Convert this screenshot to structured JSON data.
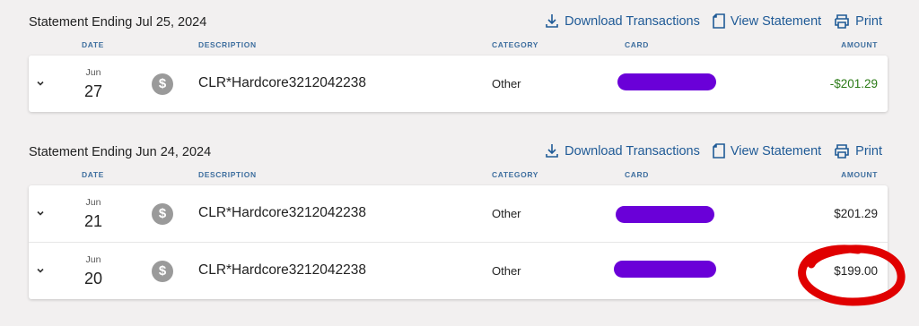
{
  "columns": {
    "date": "DATE",
    "description": "DESCRIPTION",
    "category": "CATEGORY",
    "card": "CARD",
    "amount": "AMOUNT"
  },
  "actions": {
    "download": "Download Transactions",
    "view": "View Statement",
    "print": "Print"
  },
  "colors": {
    "link": "#1f5a96",
    "redaction": "#6a00d8",
    "credit_amount": "#2b7a16",
    "annotation": "#e00000"
  },
  "statements": [
    {
      "title": "Statement Ending Jul 25, 2024",
      "transactions": [
        {
          "month": "Jun",
          "day": "27",
          "description": "CLR*Hardcore3212042238",
          "category": "Other",
          "amount": "-$201.29",
          "icon": "dollar-icon"
        }
      ]
    },
    {
      "title": "Statement Ending Jun 24, 2024",
      "transactions": [
        {
          "month": "Jun",
          "day": "21",
          "description": "CLR*Hardcore3212042238",
          "category": "Other",
          "amount": "$201.29",
          "icon": "dollar-icon"
        },
        {
          "month": "Jun",
          "day": "20",
          "description": "CLR*Hardcore3212042238",
          "category": "Other",
          "amount": "$199.00",
          "icon": "dollar-icon"
        }
      ]
    }
  ]
}
